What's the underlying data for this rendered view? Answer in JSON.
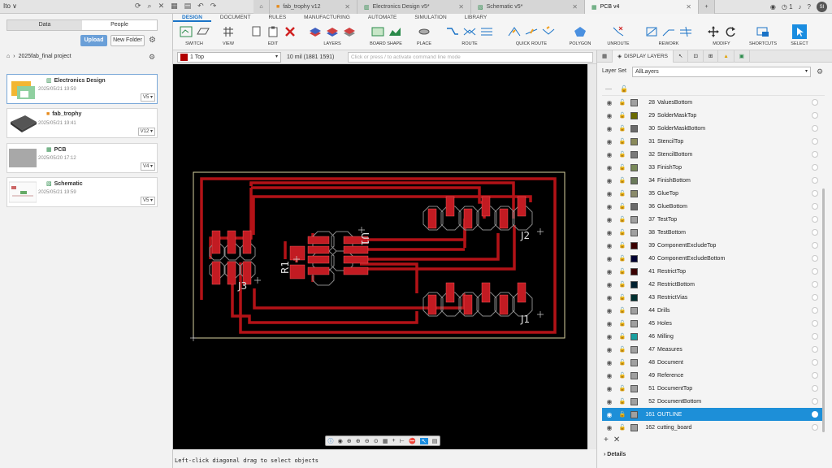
{
  "app": {
    "user": "Ito",
    "tabs": [
      {
        "label": "fab_trophy v12",
        "icon": "orange-cube-icon",
        "active": false
      },
      {
        "label": "Electronics Design v5*",
        "icon": "electronics-icon",
        "active": false
      },
      {
        "label": "Schematic v5*",
        "icon": "schematic-icon",
        "active": false
      },
      {
        "label": "PCB v4",
        "icon": "pcb-icon",
        "active": true
      }
    ],
    "notifications": "1",
    "avatar": "SI"
  },
  "left_panel": {
    "tabs": [
      "Data",
      "People"
    ],
    "upload_label": "Upload",
    "new_folder_label": "New Folder",
    "breadcrumb": "2025fab_final project",
    "files": [
      {
        "name": "Electronics Design",
        "date": "2025/05/21 19:59",
        "version": "V5"
      },
      {
        "name": "fab_trophy",
        "date": "2025/05/21 19:41",
        "version": "V12"
      },
      {
        "name": "PCB",
        "date": "2025/05/20 17:12",
        "version": "V4"
      },
      {
        "name": "Schematic",
        "date": "2025/05/21 19:59",
        "version": "V5"
      }
    ]
  },
  "ribbon": {
    "tabs": [
      "DESIGN",
      "DOCUMENT",
      "RULES",
      "MANUFACTURING",
      "AUTOMATE",
      "SIMULATION",
      "LIBRARY"
    ],
    "groups": [
      "SWITCH",
      "VIEW",
      "EDIT",
      "LAYERS",
      "BOARD SHAPE",
      "PLACE",
      "ROUTE",
      "QUICK ROUTE",
      "POLYGON",
      "UNROUTE",
      "REWORK",
      "MODIFY",
      "SHORTCUTS",
      "SELECT"
    ]
  },
  "subbar": {
    "layer": "1 Top",
    "grid": "10 mil (1881 1591)",
    "command_placeholder": "Click or press / to activate command line mode"
  },
  "canvas": {
    "labels": [
      "J1",
      "J2",
      "J3",
      "R1",
      "U1"
    ]
  },
  "status": "Left-click diagonal drag to select objects",
  "right_panel": {
    "tab_label": "DISPLAY LAYERS",
    "layer_set_label": "Layer Set",
    "layer_set_value": "AllLayers",
    "layers": [
      {
        "num": "28",
        "name": "ValuesBottom",
        "color": "#a0a0a0"
      },
      {
        "num": "29",
        "name": "SolderMaskTop",
        "color": "#6b6b00"
      },
      {
        "num": "30",
        "name": "SolderMaskBottom",
        "color": "#6b6b6b"
      },
      {
        "num": "31",
        "name": "StencilTop",
        "color": "#8a8a5a"
      },
      {
        "num": "32",
        "name": "StencilBottom",
        "color": "#7a7a7a"
      },
      {
        "num": "33",
        "name": "FinishTop",
        "color": "#7a8a5a"
      },
      {
        "num": "34",
        "name": "FinishBottom",
        "color": "#6a7a5a"
      },
      {
        "num": "35",
        "name": "GlueTop",
        "color": "#8a8a6a"
      },
      {
        "num": "36",
        "name": "GlueBottom",
        "color": "#6a6a6a"
      },
      {
        "num": "37",
        "name": "TestTop",
        "color": "#a0a0a0"
      },
      {
        "num": "38",
        "name": "TestBottom",
        "color": "#a0a0a0"
      },
      {
        "num": "39",
        "name": "ComponentExcludeTop",
        "color": "#3a0000"
      },
      {
        "num": "40",
        "name": "ComponentExcludeBottom",
        "color": "#000030"
      },
      {
        "num": "41",
        "name": "RestrictTop",
        "color": "#3a0000"
      },
      {
        "num": "42",
        "name": "RestrictBottom",
        "color": "#002030"
      },
      {
        "num": "43",
        "name": "RestrictVias",
        "color": "#003030"
      },
      {
        "num": "44",
        "name": "Drills",
        "color": "#a0a0a0"
      },
      {
        "num": "45",
        "name": "Holes",
        "color": "#a0a0a0"
      },
      {
        "num": "46",
        "name": "Milling",
        "color": "#1aa0a0"
      },
      {
        "num": "47",
        "name": "Measures",
        "color": "#a0a0a0"
      },
      {
        "num": "48",
        "name": "Document",
        "color": "#a0a0a0"
      },
      {
        "num": "49",
        "name": "Reference",
        "color": "#a0a0a0"
      },
      {
        "num": "51",
        "name": "DocumentTop",
        "color": "#a0a0a0"
      },
      {
        "num": "52",
        "name": "DocumentBottom",
        "color": "#a0a0a0"
      },
      {
        "num": "161",
        "name": "OUTLINE",
        "color": "#a0a0a0",
        "selected": true
      },
      {
        "num": "162",
        "name": "cutting_board",
        "color": "#a0a0a0"
      }
    ],
    "details_label": "Details"
  }
}
